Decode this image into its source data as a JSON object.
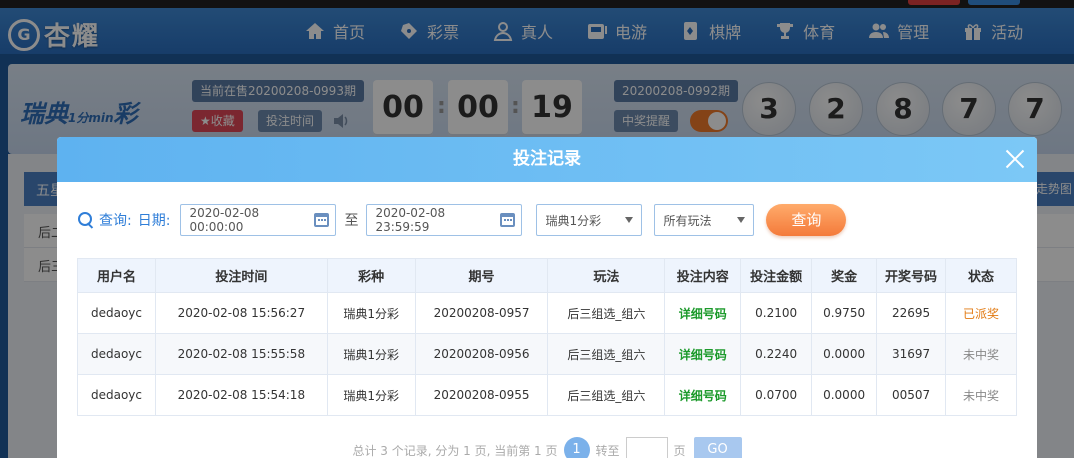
{
  "brand": {
    "logo_mark": "G",
    "logo_text": "杏耀"
  },
  "nav": [
    {
      "label": "首页",
      "icon": "home-icon"
    },
    {
      "label": "彩票",
      "icon": "lottery-icon"
    },
    {
      "label": "真人",
      "icon": "live-dealer-icon"
    },
    {
      "label": "电游",
      "icon": "slot-machine-icon"
    },
    {
      "label": "棋牌",
      "icon": "cards-icon"
    },
    {
      "label": "体育",
      "icon": "trophy-icon"
    },
    {
      "label": "管理",
      "icon": "users-icon"
    },
    {
      "label": "活动",
      "icon": "gift-icon"
    }
  ],
  "lottery": {
    "logo_text": "瑞典",
    "logo_sub": "1分min",
    "logo_suffix": "彩",
    "current_issue": "当前在售20200208-0993期",
    "favorite": "★收藏",
    "bet_time": "投注时间",
    "countdown": [
      "00",
      "00",
      "19"
    ],
    "last_issue": "20200208-0992期",
    "win_alert": "中奖提醒",
    "balls": [
      "3",
      "2",
      "8",
      "7",
      "7"
    ]
  },
  "behind": {
    "sub_title": "五星",
    "row1": "后二",
    "row2": "后三",
    "right_tag": "走势图"
  },
  "modal": {
    "title": "投注记录",
    "filter": {
      "query_label": "查询:",
      "date_label": "日期:",
      "start_date": "2020-02-08 00:00:00",
      "to_label": "至",
      "end_date": "2020-02-08 23:59:59",
      "lottery_select": "瑞典1分彩",
      "play_select": "所有玩法",
      "query_button": "查询"
    },
    "columns": [
      "用户名",
      "投注时间",
      "彩种",
      "期号",
      "玩法",
      "投注内容",
      "投注金额",
      "奖金",
      "开奖号码",
      "状态"
    ],
    "rows": [
      {
        "user": "dedaoyc",
        "time": "2020-02-08 15:56:27",
        "lottery": "瑞典1分彩",
        "issue": "20200208-0957",
        "play": "后三组选_组六",
        "content": "详细号码",
        "amount": "0.2100",
        "prize": "0.9750",
        "number": "22695",
        "status": "已派奖",
        "status_color": "#e27a12"
      },
      {
        "user": "dedaoyc",
        "time": "2020-02-08 15:55:58",
        "lottery": "瑞典1分彩",
        "issue": "20200208-0956",
        "play": "后三组选_组六",
        "content": "详细号码",
        "amount": "0.2240",
        "prize": "0.0000",
        "number": "31697",
        "status": "未中奖",
        "status_color": "#888888"
      },
      {
        "user": "dedaoyc",
        "time": "2020-02-08 15:54:18",
        "lottery": "瑞典1分彩",
        "issue": "20200208-0955",
        "play": "后三组选_组六",
        "content": "详细号码",
        "amount": "0.0700",
        "prize": "0.0000",
        "number": "00507",
        "status": "未中奖",
        "status_color": "#888888"
      }
    ],
    "pager": {
      "summary": "总计 3 个记录, 分为 1 页, 当前第 1 页",
      "current_page": "1",
      "goto_label": "转至",
      "page_label": "页",
      "go_button": "GO"
    }
  },
  "colors": {
    "accent": "#2f7ed8",
    "header_gradient_start": "#5eb2f0",
    "query_button": "#f47a3a",
    "detail_link": "#1c9a2b"
  }
}
